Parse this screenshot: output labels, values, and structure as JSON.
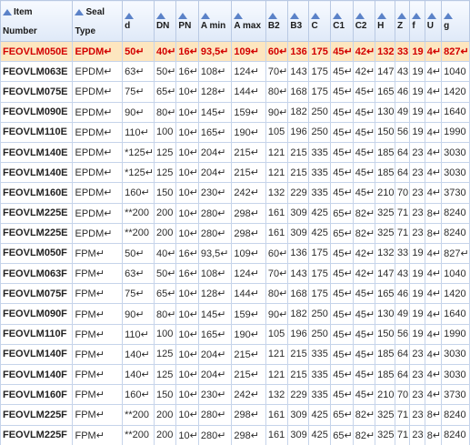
{
  "columns": [
    {
      "l1": "Item",
      "l2": "Number"
    },
    {
      "l1": "Seal",
      "l2": "Type"
    },
    {
      "l1": "d"
    },
    {
      "l1": "DN"
    },
    {
      "l1": "PN"
    },
    {
      "l1": "A min"
    },
    {
      "l1": "A max"
    },
    {
      "l1": "B2"
    },
    {
      "l1": "B3"
    },
    {
      "l1": "C"
    },
    {
      "l1": "C1"
    },
    {
      "l1": "C2"
    },
    {
      "l1": "H"
    },
    {
      "l1": "Z"
    },
    {
      "l1": "f"
    },
    {
      "l1": "U"
    },
    {
      "l1": "g"
    }
  ],
  "selected_row": 0,
  "rows": [
    [
      "FEOVLM050E",
      "EPDM↵",
      "50↵",
      "40↵",
      "16↵",
      "93,5↵",
      "109↵",
      "60↵",
      "136",
      "175",
      "45↵",
      "42↵",
      "132",
      "33",
      "19",
      "4↵",
      "827↵"
    ],
    [
      "FEOVLM063E",
      "EPDM↵",
      "63↵",
      "50↵",
      "16↵",
      "108↵",
      "124↵",
      "70↵",
      "143",
      "175",
      "45↵",
      "42↵",
      "147",
      "43",
      "19",
      "4↵",
      "1040"
    ],
    [
      "FEOVLM075E",
      "EPDM↵",
      "75↵",
      "65↵",
      "10↵",
      "128↵",
      "144↵",
      "80↵",
      "168",
      "175",
      "45↵",
      "45↵",
      "165",
      "46",
      "19",
      "4↵",
      "1420"
    ],
    [
      "FEOVLM090E",
      "EPDM↵",
      "90↵",
      "80↵",
      "10↵",
      "145↵",
      "159↵",
      "90↵",
      "182",
      "250",
      "45↵",
      "45↵",
      "130",
      "49",
      "19",
      "4↵",
      "1640"
    ],
    [
      "FEOVLM110E",
      "EPDM↵",
      "110↵",
      "100",
      "10↵",
      "165↵",
      "190↵",
      "105",
      "196",
      "250",
      "45↵",
      "45↵",
      "150",
      "56",
      "19",
      "4↵",
      "1990"
    ],
    [
      "FEOVLM140E",
      "EPDM↵",
      "*125↵",
      "125",
      "10↵",
      "204↵",
      "215↵",
      "121",
      "215",
      "335",
      "45↵",
      "45↵",
      "185",
      "64",
      "23",
      "4↵",
      "3030"
    ],
    [
      "FEOVLM140E",
      "EPDM↵",
      "*125↵",
      "125",
      "10↵",
      "204↵",
      "215↵",
      "121",
      "215",
      "335",
      "45↵",
      "45↵",
      "185",
      "64",
      "23",
      "4↵",
      "3030"
    ],
    [
      "FEOVLM160E",
      "EPDM↵",
      "160↵",
      "150",
      "10↵",
      "230↵",
      "242↵",
      "132",
      "229",
      "335",
      "45↵",
      "45↵",
      "210",
      "70",
      "23",
      "4↵",
      "3730"
    ],
    [
      "FEOVLM225E",
      "EPDM↵",
      "**200",
      "200",
      "10↵",
      "280↵",
      "298↵",
      "161",
      "309",
      "425",
      "65↵",
      "82↵",
      "325",
      "71",
      "23",
      "8↵",
      "8240"
    ],
    [
      "FEOVLM225E",
      "EPDM↵",
      "**200",
      "200",
      "10↵",
      "280↵",
      "298↵",
      "161",
      "309",
      "425",
      "65↵",
      "82↵",
      "325",
      "71",
      "23",
      "8↵",
      "8240"
    ],
    [
      "FEOVLM050F",
      "FPM↵",
      "50↵",
      "40↵",
      "16↵",
      "93,5↵",
      "109↵",
      "60↵",
      "136",
      "175",
      "45↵",
      "42↵",
      "132",
      "33",
      "19",
      "4↵",
      "827↵"
    ],
    [
      "FEOVLM063F",
      "FPM↵",
      "63↵",
      "50↵",
      "16↵",
      "108↵",
      "124↵",
      "70↵",
      "143",
      "175",
      "45↵",
      "42↵",
      "147",
      "43",
      "19",
      "4↵",
      "1040"
    ],
    [
      "FEOVLM075F",
      "FPM↵",
      "75↵",
      "65↵",
      "10↵",
      "128↵",
      "144↵",
      "80↵",
      "168",
      "175",
      "45↵",
      "45↵",
      "165",
      "46",
      "19",
      "4↵",
      "1420"
    ],
    [
      "FEOVLM090F",
      "FPM↵",
      "90↵",
      "80↵",
      "10↵",
      "145↵",
      "159↵",
      "90↵",
      "182",
      "250",
      "45↵",
      "45↵",
      "130",
      "49",
      "19",
      "4↵",
      "1640"
    ],
    [
      "FEOVLM110F",
      "FPM↵",
      "110↵",
      "100",
      "10↵",
      "165↵",
      "190↵",
      "105",
      "196",
      "250",
      "45↵",
      "45↵",
      "150",
      "56",
      "19",
      "4↵",
      "1990"
    ],
    [
      "FEOVLM140F",
      "FPM↵",
      "140↵",
      "125",
      "10↵",
      "204↵",
      "215↵",
      "121",
      "215",
      "335",
      "45↵",
      "45↵",
      "185",
      "64",
      "23",
      "4↵",
      "3030"
    ],
    [
      "FEOVLM140F",
      "FPM↵",
      "140↵",
      "125",
      "10↵",
      "204↵",
      "215↵",
      "121",
      "215",
      "335",
      "45↵",
      "45↵",
      "185",
      "64",
      "23",
      "4↵",
      "3030"
    ],
    [
      "FEOVLM160F",
      "FPM↵",
      "160↵",
      "150",
      "10↵",
      "230↵",
      "242↵",
      "132",
      "229",
      "335",
      "45↵",
      "45↵",
      "210",
      "70",
      "23",
      "4↵",
      "3730"
    ],
    [
      "FEOVLM225F",
      "FPM↵",
      "**200",
      "200",
      "10↵",
      "280↵",
      "298↵",
      "161",
      "309",
      "425",
      "65↵",
      "82↵",
      "325",
      "71",
      "23",
      "8↵",
      "8240"
    ],
    [
      "FEOVLM225F",
      "FPM↵",
      "**200",
      "200",
      "10↵",
      "280↵",
      "298↵",
      "161",
      "309",
      "425",
      "65↵",
      "82↵",
      "325",
      "71",
      "23",
      "8↵",
      "8240"
    ]
  ]
}
